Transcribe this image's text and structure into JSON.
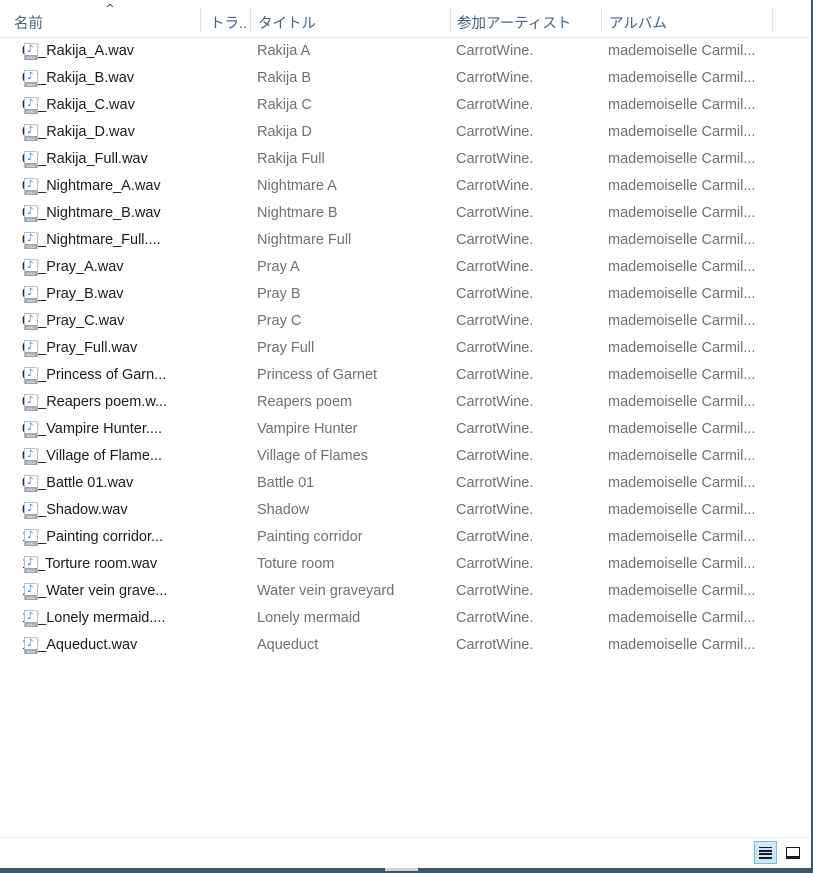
{
  "window": {
    "view_mode": "details",
    "accent_color": "#cce8f4",
    "header_text_color": "#46637f",
    "border_color": "#3d5566"
  },
  "columns": [
    {
      "key": "name",
      "label": "名前",
      "icon": "sort-ascending-icon"
    },
    {
      "key": "track",
      "label": "トラ...",
      "icon": ""
    },
    {
      "key": "title",
      "label": "タイトル",
      "icon": ""
    },
    {
      "key": "artist",
      "label": "参加アーティスト",
      "icon": ""
    },
    {
      "key": "album",
      "label": "アルバム",
      "icon": ""
    }
  ],
  "sort": {
    "column": "名前",
    "direction": "ascending",
    "glyph": "^"
  },
  "file_icon": {
    "name": "wav-file-icon",
    "note_glyph": "♪",
    "type_tag": "WAV"
  },
  "rows": [
    {
      "name": "01_Rakija_A.wav",
      "track": "",
      "title": "Rakija A",
      "artist": "CarrotWine.",
      "album": "mademoiselle Carmil..."
    },
    {
      "name": "01_Rakija_B.wav",
      "track": "",
      "title": "Rakija B",
      "artist": "CarrotWine.",
      "album": "mademoiselle Carmil..."
    },
    {
      "name": "01_Rakija_C.wav",
      "track": "",
      "title": "Rakija C",
      "artist": "CarrotWine.",
      "album": "mademoiselle Carmil..."
    },
    {
      "name": "01_Rakija_D.wav",
      "track": "",
      "title": "Rakija D",
      "artist": "CarrotWine.",
      "album": "mademoiselle Carmil..."
    },
    {
      "name": "01_Rakija_Full.wav",
      "track": "",
      "title": "Rakija Full",
      "artist": "CarrotWine.",
      "album": "mademoiselle Carmil..."
    },
    {
      "name": "02_Nightmare_A.wav",
      "track": "",
      "title": "Nightmare A",
      "artist": "CarrotWine.",
      "album": "mademoiselle Carmil..."
    },
    {
      "name": "02_Nightmare_B.wav",
      "track": "",
      "title": "Nightmare B",
      "artist": "CarrotWine.",
      "album": "mademoiselle Carmil..."
    },
    {
      "name": "02_Nightmare_Full....",
      "track": "",
      "title": "Nightmare Full",
      "artist": "CarrotWine.",
      "album": "mademoiselle Carmil..."
    },
    {
      "name": "03_Pray_A.wav",
      "track": "",
      "title": "Pray A",
      "artist": "CarrotWine.",
      "album": "mademoiselle Carmil..."
    },
    {
      "name": "03_Pray_B.wav",
      "track": "",
      "title": "Pray B",
      "artist": "CarrotWine.",
      "album": "mademoiselle Carmil..."
    },
    {
      "name": "03_Pray_C.wav",
      "track": "",
      "title": "Pray C",
      "artist": "CarrotWine.",
      "album": "mademoiselle Carmil..."
    },
    {
      "name": "03_Pray_Full.wav",
      "track": "",
      "title": "Pray Full",
      "artist": "CarrotWine.",
      "album": "mademoiselle Carmil..."
    },
    {
      "name": "04_Princess of Garn...",
      "track": "",
      "title": "Princess of Garnet",
      "artist": "CarrotWine.",
      "album": "mademoiselle Carmil..."
    },
    {
      "name": "05_Reapers poem.w...",
      "track": "",
      "title": "Reapers poem",
      "artist": "CarrotWine.",
      "album": "mademoiselle Carmil..."
    },
    {
      "name": "06_Vampire Hunter....",
      "track": "",
      "title": "Vampire Hunter",
      "artist": "CarrotWine.",
      "album": "mademoiselle Carmil..."
    },
    {
      "name": "07_Village of Flame...",
      "track": "",
      "title": "Village of Flames",
      "artist": "CarrotWine.",
      "album": "mademoiselle Carmil..."
    },
    {
      "name": "08_Battle 01.wav",
      "track": "",
      "title": "Battle 01",
      "artist": "CarrotWine.",
      "album": "mademoiselle Carmil..."
    },
    {
      "name": "09_Shadow.wav",
      "track": "",
      "title": "Shadow",
      "artist": "CarrotWine.",
      "album": "mademoiselle Carmil..."
    },
    {
      "name": "10_Painting corridor...",
      "track": "",
      "title": "Painting corridor",
      "artist": "CarrotWine.",
      "album": "mademoiselle Carmil..."
    },
    {
      "name": "11_Torture room.wav",
      "track": "",
      "title": "Toture room",
      "artist": "CarrotWine.",
      "album": "mademoiselle Carmil..."
    },
    {
      "name": "12_Water vein grave...",
      "track": "",
      "title": "Water vein graveyard",
      "artist": "CarrotWine.",
      "album": "mademoiselle Carmil..."
    },
    {
      "name": "13_Lonely mermaid....",
      "track": "",
      "title": "Lonely mermaid",
      "artist": "CarrotWine.",
      "album": "mademoiselle Carmil..."
    },
    {
      "name": "14_Aqueduct.wav",
      "track": "",
      "title": "Aqueduct",
      "artist": "CarrotWine.",
      "album": "mademoiselle Carmil..."
    }
  ],
  "status_bar": {
    "text": "",
    "view_buttons": [
      {
        "name": "details-view-button",
        "icon": "details-view-icon",
        "active": true
      },
      {
        "name": "large-icons-view-button",
        "icon": "large-icons-view-icon",
        "active": false
      }
    ]
  }
}
